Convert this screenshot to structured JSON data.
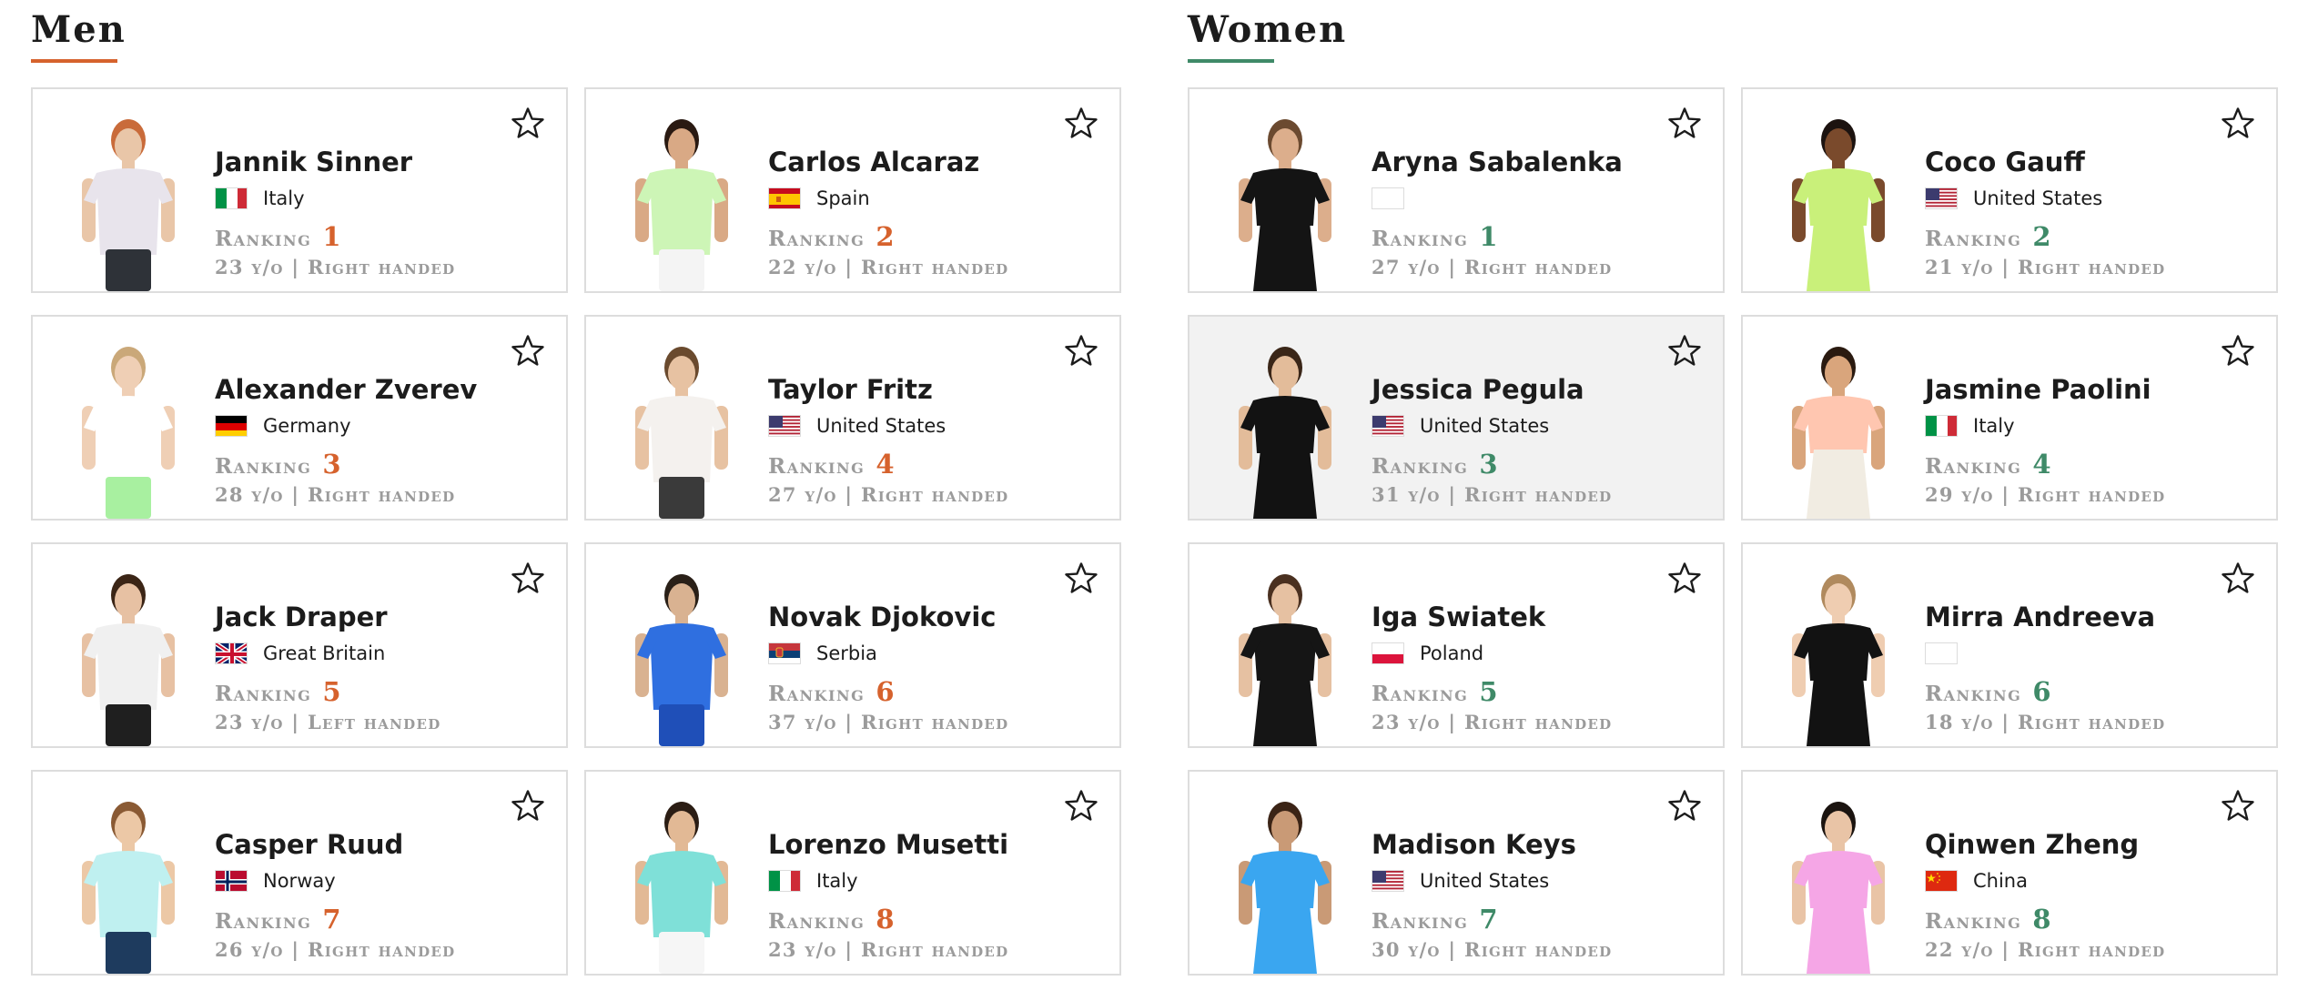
{
  "sections": [
    {
      "title": "Men",
      "players": [
        {
          "name": "Jannik Sinner",
          "country": "Italy",
          "flag": "it",
          "ranking_label": "Ranking",
          "ranking": "1",
          "details": "23 y/o | Right handed",
          "shirt": "#e8e4ec",
          "shorts": "#2e3238",
          "skin": "#e9c6a8",
          "hair": "#c96b3a"
        },
        {
          "name": "Carlos Alcaraz",
          "country": "Spain",
          "flag": "es",
          "ranking_label": "Ranking",
          "ranking": "2",
          "details": "22 y/o | Right handed",
          "shirt": "#cdf5b6",
          "shorts": "#f4f4f4",
          "skin": "#d9a985",
          "hair": "#2a1a12"
        },
        {
          "name": "Alexander Zverev",
          "country": "Germany",
          "flag": "de",
          "ranking_label": "Ranking",
          "ranking": "3",
          "details": "28 y/o | Right handed",
          "shirt": "#ffffff",
          "shorts": "#a8f0a0",
          "skin": "#efcfb5",
          "hair": "#caa879"
        },
        {
          "name": "Taylor Fritz",
          "country": "United States",
          "flag": "us",
          "ranking_label": "Ranking",
          "ranking": "4",
          "details": "27 y/o | Right handed",
          "shirt": "#f4f1ee",
          "shorts": "#3a3a3a",
          "skin": "#e7c2a2",
          "hair": "#6a4a2e"
        },
        {
          "name": "Jack Draper",
          "country": "Great Britain",
          "flag": "gb",
          "ranking_label": "Ranking",
          "ranking": "5",
          "details": "23 y/o | Left handed",
          "shirt": "#f0f0f0",
          "shorts": "#1f1f1f",
          "skin": "#e7c1a3",
          "hair": "#3b2516"
        },
        {
          "name": "Novak Djokovic",
          "country": "Serbia",
          "flag": "rs",
          "ranking_label": "Ranking",
          "ranking": "6",
          "details": "37 y/o | Right handed",
          "shirt": "#2f6fe0",
          "shorts": "#1f4fb8",
          "skin": "#d9b291",
          "hair": "#2a2018"
        },
        {
          "name": "Casper Ruud",
          "country": "Norway",
          "flag": "no",
          "ranking_label": "Ranking",
          "ranking": "7",
          "details": "26 y/o | Right handed",
          "shirt": "#bff0f0",
          "shorts": "#1e3b5e",
          "skin": "#ecc8a6",
          "hair": "#8a5a34"
        },
        {
          "name": "Lorenzo Musetti",
          "country": "Italy",
          "flag": "it",
          "ranking_label": "Ranking",
          "ranking": "8",
          "details": "23 y/o | Right handed",
          "shirt": "#7fe0d8",
          "shorts": "#f6f6f6",
          "skin": "#e2b995",
          "hair": "#2b1d14"
        }
      ]
    },
    {
      "title": "Women",
      "players": [
        {
          "name": "Aryna Sabalenka",
          "country": "",
          "flag": "blank",
          "ranking_label": "Ranking",
          "ranking": "1",
          "details": "27 y/o | Right handed",
          "shirt": "#141414",
          "shorts": "#141414",
          "skin": "#dcae8c",
          "hair": "#6b4a30"
        },
        {
          "name": "Coco Gauff",
          "country": "United States",
          "flag": "us",
          "ranking_label": "Ranking",
          "ranking": "2",
          "details": "21 y/o | Right handed",
          "shirt": "#c9f07a",
          "shorts": "#c9f07a",
          "skin": "#7a4a2c",
          "hair": "#1c1310"
        },
        {
          "name": "Jessica Pegula",
          "country": "United States",
          "flag": "us",
          "ranking_label": "Ranking",
          "ranking": "3",
          "details": "31 y/o | Right handed",
          "shirt": "#121212",
          "shorts": "#121212",
          "skin": "#e3bc9a",
          "hair": "#3a2618"
        },
        {
          "name": "Jasmine Paolini",
          "country": "Italy",
          "flag": "it",
          "ranking_label": "Ranking",
          "ranking": "4",
          "details": "29 y/o | Right handed",
          "shirt": "#ffc6b0",
          "shorts": "#f1ece2",
          "skin": "#d9a57c",
          "hair": "#2a1a10"
        },
        {
          "name": "Iga Swiatek",
          "country": "Poland",
          "flag": "pl",
          "ranking_label": "Ranking",
          "ranking": "5",
          "details": "23 y/o | Right handed",
          "shirt": "#151515",
          "shorts": "#151515",
          "skin": "#e6c1a2",
          "hair": "#4a3020"
        },
        {
          "name": "Mirra Andreeva",
          "country": "",
          "flag": "blank",
          "ranking_label": "Ranking",
          "ranking": "6",
          "details": "18 y/o | Right handed",
          "shirt": "#121212",
          "shorts": "#121212",
          "skin": "#efcdb1",
          "hair": "#b08a5e"
        },
        {
          "name": "Madison Keys",
          "country": "United States",
          "flag": "us",
          "ranking_label": "Ranking",
          "ranking": "7",
          "details": "30 y/o | Right handed",
          "shirt": "#3aa6f0",
          "shorts": "#3aa6f0",
          "skin": "#c99a76",
          "hair": "#3b2416"
        },
        {
          "name": "Qinwen Zheng",
          "country": "China",
          "flag": "cn",
          "ranking_label": "Ranking",
          "ranking": "8",
          "details": "22 y/o | Right handed",
          "shirt": "#f5a6e6",
          "shorts": "#f5a6e6",
          "skin": "#e9c4a6",
          "hair": "#1b1410"
        }
      ]
    }
  ],
  "colors": {
    "men_accent": "#d6622d",
    "women_accent": "#3f8a68",
    "card_border": "#dddddd",
    "hover_card_bg": "#f2f2f2",
    "muted_text": "#9b9b9b"
  },
  "icons": {
    "favorite": "star-outline-icon"
  },
  "state": {
    "hovered_card": "Jessica Pegula"
  }
}
